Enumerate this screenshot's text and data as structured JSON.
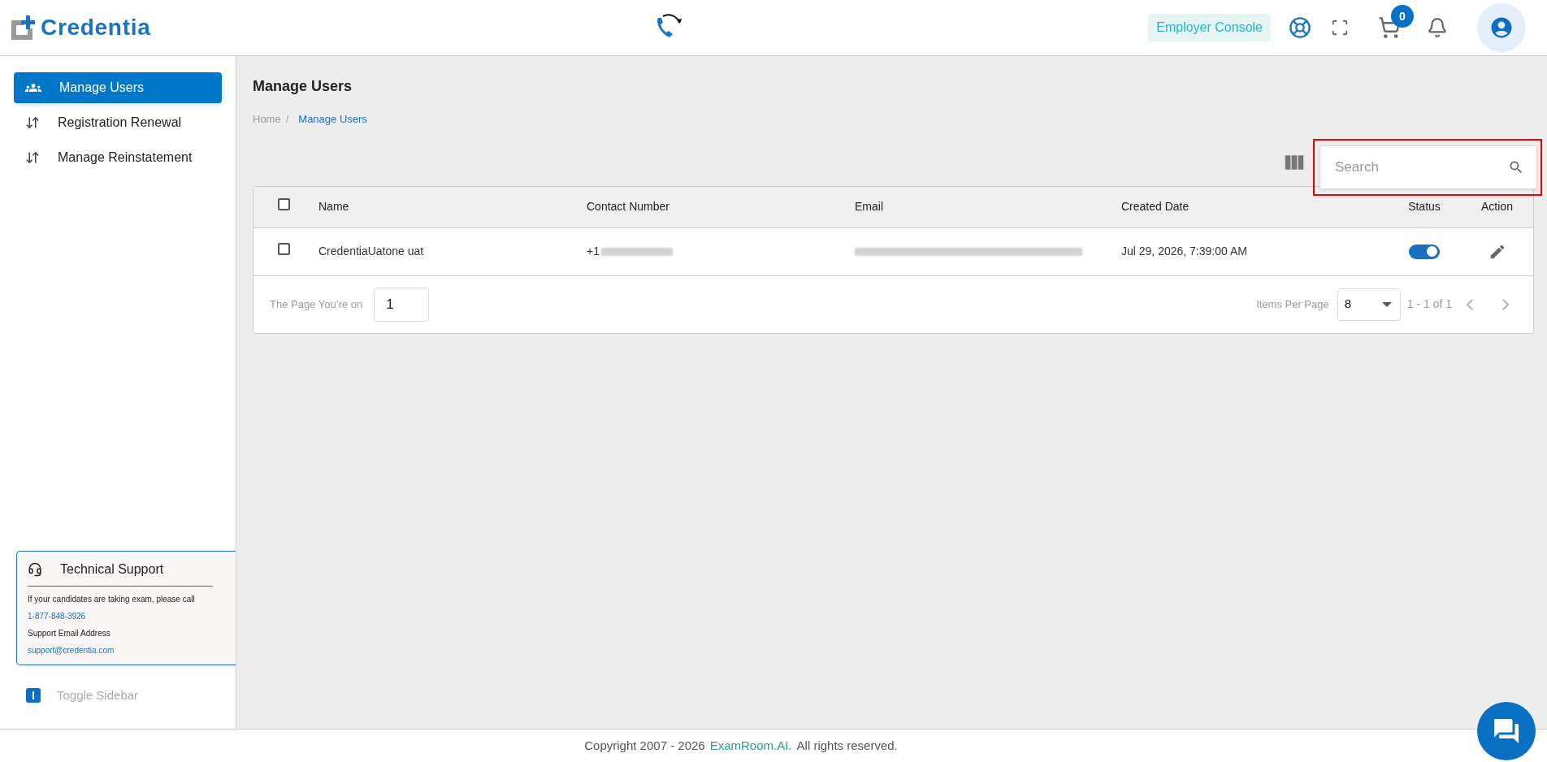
{
  "header": {
    "logo": "Credentia",
    "console_button": "Employer Console",
    "cart_count": "0"
  },
  "sidebar": {
    "items": [
      {
        "label": "Manage Users",
        "selected": true,
        "kind": "users"
      },
      {
        "label": "Registration Renewal",
        "selected": false,
        "kind": "swap"
      },
      {
        "label": "Manage Reinstatement",
        "selected": false,
        "kind": "swap"
      }
    ],
    "support": {
      "title": "Technical Support",
      "lines": [
        {
          "text": "If your candidates are taking exam, please call",
          "kind": "text"
        },
        {
          "text": "1-877-848-3926",
          "kind": "link"
        },
        {
          "text": "Support Email Address",
          "kind": "text"
        },
        {
          "text": "support@credentia.com",
          "kind": "link"
        }
      ]
    },
    "toggle": "Toggle Sidebar"
  },
  "page": {
    "title": "Manage Users",
    "separator": "/",
    "breadcrumb": [
      {
        "label": "Home",
        "selected": false
      },
      {
        "label": "Manage Users",
        "selected": true
      }
    ]
  },
  "search": {
    "placeholder": "Search"
  },
  "table": {
    "all_checked": false,
    "columns": [
      "Name",
      "Contact Number",
      "Email",
      "Created Date",
      "Status",
      "Action"
    ],
    "rows": [
      {
        "checked": false,
        "name": "CredentiaUatone uat",
        "contact": "+1",
        "created": "Jul 29, 2026, 7:39:00 AM",
        "on": true
      }
    ]
  },
  "pagination": {
    "page_label": "The Page You’re on",
    "page": "1",
    "per_page_label": "Items Per Page",
    "per_page": "8",
    "range": "1 - 1 of 1"
  },
  "footer": {
    "copyright": "Copyright 2007 - 2026",
    "link": "ExamRoom.AI.",
    "rest": "All rights reserved."
  }
}
